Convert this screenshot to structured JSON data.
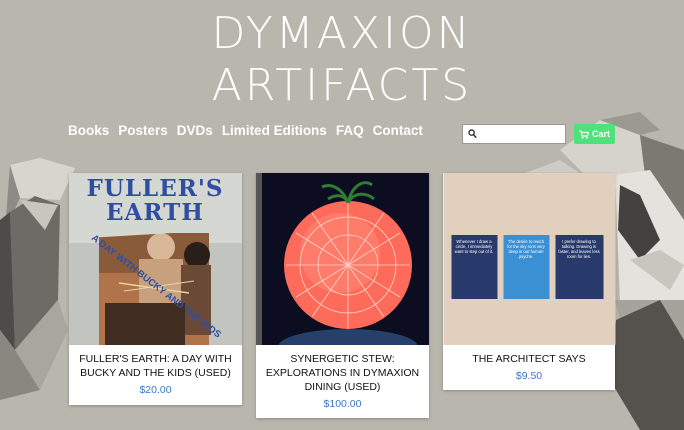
{
  "site": {
    "title_line1": "DYMAXION",
    "title_line2": "ARTIFACTS"
  },
  "nav": {
    "items": [
      "Books",
      "Posters",
      "DVDs",
      "Limited Editions",
      "FAQ",
      "Contact"
    ]
  },
  "search": {
    "placeholder": "",
    "value": "",
    "icon": "search-icon"
  },
  "cart": {
    "label": "Cart",
    "icon": "cart-icon",
    "color": "#4ee27b"
  },
  "products": [
    {
      "title": "FULLER'S EARTH: A DAY WITH BUCKY AND THE KIDS (USED)",
      "price": "$20.00",
      "cover_title": "FULLER'S EARTH",
      "cover_subtitle": "A DAY WITH BUCKY AND THE KIDS"
    },
    {
      "title": "SYNERGETIC STEW: EXPLORATIONS IN DYMAXION DINING (USED)",
      "price": "$100.00"
    },
    {
      "title": "THE ARCHITECT SAYS",
      "price": "$9.50",
      "quotes": [
        "Whenever I draw a circle, I immediately want to step out of it.",
        "The desire to reach for the sky runs very deep in our human psyche.",
        "I prefer drawing to talking. Drawing is faster, and leaves less room for lies."
      ]
    }
  ],
  "colors": {
    "background": "#b9b6ad",
    "price": "#3b7ac4",
    "title": "#ffffff"
  }
}
